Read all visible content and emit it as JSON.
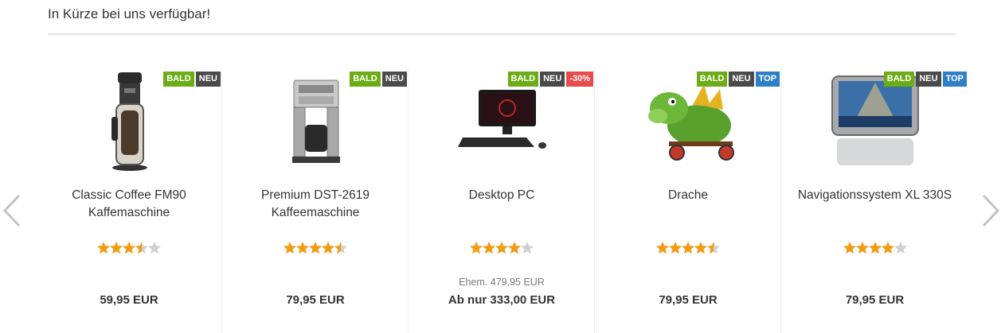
{
  "heading": "In Kürze bei uns verfügbar!",
  "colors": {
    "star": "#f39c12",
    "star_empty": "#d0d0d0",
    "bald": "#6cac16",
    "neu": "#4a4a4a",
    "top": "#2f7fc6",
    "sale": "#e84b4b"
  },
  "nav": {
    "prev_icon": "chevron-left-icon",
    "next_icon": "chevron-right-icon"
  },
  "products": [
    {
      "name": "Classic Coffee FM90 Kaffemaschine",
      "badges": [
        "BALD",
        "NEU"
      ],
      "rating": 3.5,
      "old_price": "",
      "price": "59,95 EUR",
      "image": "coffee-machine-image"
    },
    {
      "name": "Premium DST-2619 Kaffeemaschine",
      "badges": [
        "BALD",
        "NEU"
      ],
      "rating": 4.5,
      "old_price": "",
      "price": "79,95 EUR",
      "image": "coffee-maker-image"
    },
    {
      "name": "Desktop PC",
      "badges": [
        "BALD",
        "NEU",
        "-30%"
      ],
      "rating": 4,
      "old_price": "Ehem. 479,95 EUR",
      "price": "Ab nur 333,00 EUR",
      "image": "desktop-pc-image"
    },
    {
      "name": "Drache",
      "badges": [
        "BALD",
        "NEU",
        "TOP"
      ],
      "rating": 4.5,
      "old_price": "",
      "price": "79,95 EUR",
      "image": "dragon-toy-image"
    },
    {
      "name": "Navigationssystem XL 330S",
      "badges": [
        "BALD",
        "NEU",
        "TOP"
      ],
      "rating": 4,
      "old_price": "",
      "price": "79,95 EUR",
      "image": "navigation-device-image"
    }
  ]
}
